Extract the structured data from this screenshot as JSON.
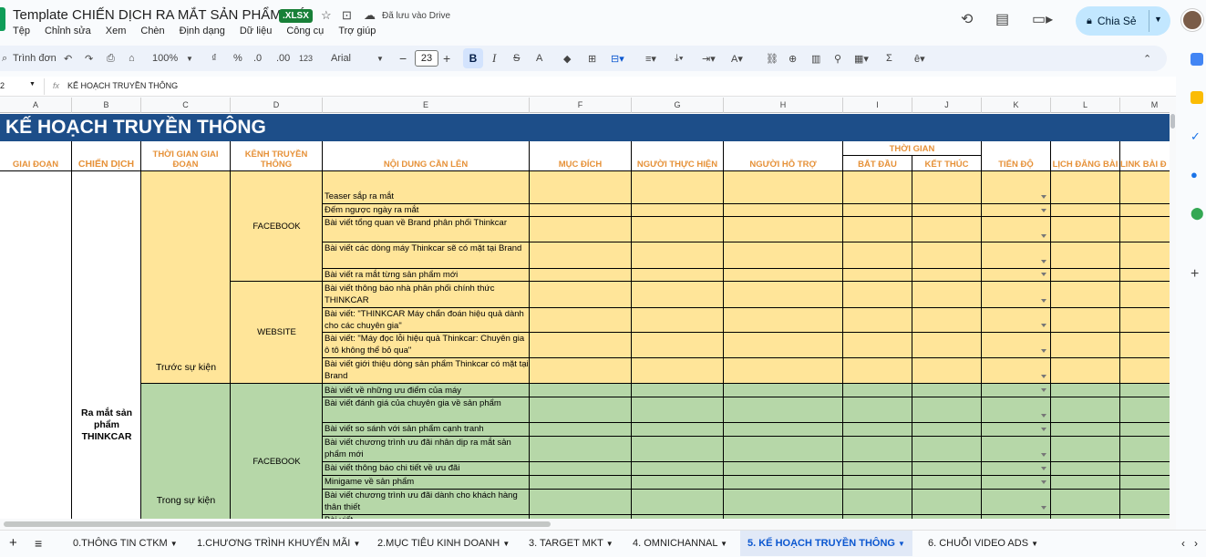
{
  "app": {
    "title": "Template CHIẾN DỊCH RA MẮT SẢN PHẨM MỚI",
    "badge": ".XLSX",
    "saved_status": "Đã lưu vào Drive",
    "share_label": "Chia Sẻ"
  },
  "menu": [
    "Tệp",
    "Chỉnh sửa",
    "Xem",
    "Chèn",
    "Định dạng",
    "Dữ liệu",
    "Công cụ",
    "Trợ giúp"
  ],
  "toolbar": {
    "search": "Trình đơn",
    "zoom": "100%",
    "currency": "₫",
    "percent": "%",
    "dec_less": ".0",
    "dec_more": ".00",
    "number_format": "123",
    "font": "Arial",
    "font_size": "23",
    "bold": "B",
    "italic": "I",
    "strike": "S",
    "text_color": "A",
    "sum": "Σ"
  },
  "formula_bar": {
    "cell_ref": "2",
    "fx": "fx",
    "content": "KẾ HOẠCH TRUYỀN THÔNG"
  },
  "columns": [
    "A",
    "B",
    "C",
    "D",
    "E",
    "F",
    "G",
    "H",
    "I",
    "J",
    "K",
    "L",
    "M"
  ],
  "sheet": {
    "banner": "KẾ HOẠCH TRUYỀN THÔNG",
    "headers": {
      "giai_doan": "GIAI ĐOẠN",
      "chien_dich": "CHIẾN DỊCH",
      "thoi_gian_giai_doan": "THỜI GIAN GIAI ĐOẠN",
      "kenh": "KÊNH TRUYỀN THÔNG",
      "noi_dung": "NỘI DUNG CẦN LÊN",
      "muc_dich": "MỤC ĐÍCH",
      "nguoi_thuc_hien": "NGƯỜI THỰC HIỆN",
      "nguoi_ho_tro": "NGƯỜI HỖ TRỢ",
      "thoi_gian": "THỜI GIAN",
      "bat_dau": "BẮT ĐẦU",
      "ket_thuc": "KẾT THÚC",
      "tien_do": "TIẾN ĐỘ",
      "lich_dang_bai": "LỊCH ĐĂNG BÀI",
      "link_bai": "LINK BÀI Đ"
    },
    "campaign": "Ra mắt sản phẩm THINKCAR",
    "phase1": "Trước sự kiện",
    "phase2": "Trong sự kiện",
    "channel_fb1": "FACEBOOK",
    "channel_web": "WEBSITE",
    "channel_fb2": "FACEBOOK",
    "rows1": [
      "Teaser sắp ra mắt",
      "Đếm ngược ngày ra mắt",
      "Bài viết tổng quan về Brand phân phối Thinkcar",
      "Bài viết các dòng máy Thinkcar sẽ có mặt tại Brand",
      "Bài viết ra mắt từng sản phẩm mới",
      "Bài viết thông báo nhà phân phối chính thức THINKCAR",
      "Bài viết: \"THINKCAR Máy chẩn đoán hiệu quả dành cho các chuyên gia\"",
      "Bài viết: \"Máy đọc lỗi hiệu quả Thinkcar: Chuyên gia ô tô không thể bỏ qua\"",
      "Bài viết giới thiệu dòng sản phẩm Thinkcar có mặt tại Brand"
    ],
    "rows2": [
      "Bài viết về những ưu điểm của máy",
      "Bài viết đánh giá của chuyên gia về sản phẩm",
      "Bài viết so sánh với sản phẩm cạnh tranh",
      "Bài viết chương trình ưu đãi nhân dịp ra mắt sản phẩm mới",
      "Bài viết thông báo chi tiết về ưu đãi",
      "Minigame về sản phẩm",
      "Bài viết chương trình ưu đãi dành cho khách hàng thân thiết",
      "Bài viết ..."
    ]
  },
  "sheet_tabs": [
    "0.THÔNG TIN CTKM",
    "1.CHƯƠNG TRÌNH KHUYẾN MÃI",
    "2.MỤC TIÊU KINH DOANH",
    "3. TARGET MKT",
    "4. OMNICHANNAL",
    "5. KẾ HOẠCH TRUYỀN THÔNG",
    "6. CHUỖI VIDEO ADS"
  ],
  "colors": {
    "banner": "#1d4e89",
    "header_text": "#e69138",
    "phase1_fill": "#ffe599",
    "phase2_fill": "#b6d7a8",
    "share_button": "#c2e7ff",
    "active_tab": "#0b57d0"
  }
}
